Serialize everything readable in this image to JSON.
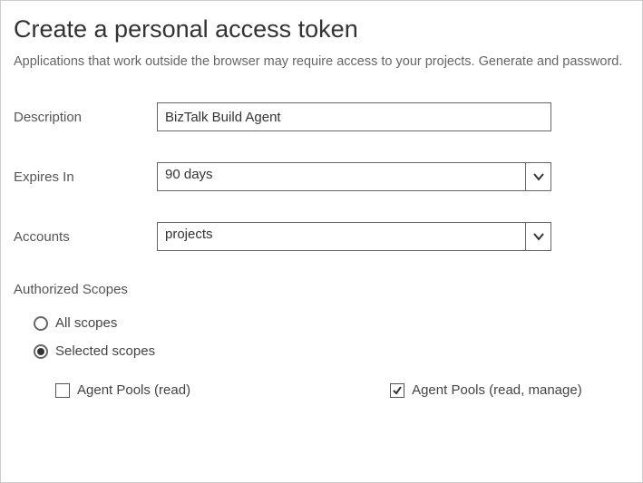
{
  "page": {
    "title": "Create a personal access token",
    "subtitle": "Applications that work outside the browser may require access to your projects. Generate and password."
  },
  "form": {
    "description": {
      "label": "Description",
      "value": "BizTalk Build Agent"
    },
    "expires": {
      "label": "Expires In",
      "value": "90 days"
    },
    "accounts": {
      "label": "Accounts",
      "value": "projects"
    }
  },
  "scopes": {
    "header": "Authorized Scopes",
    "allScopes": "All scopes",
    "selectedScopes": "Selected scopes",
    "agentPoolsRead": "Agent Pools (read)",
    "agentPoolsReadManage": "Agent Pools (read, manage)"
  }
}
